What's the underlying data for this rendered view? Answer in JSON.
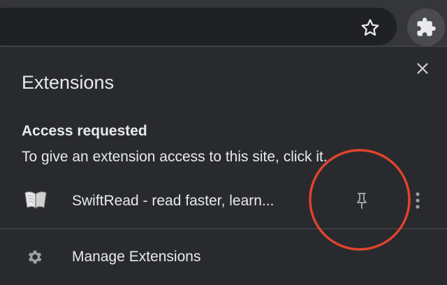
{
  "panel": {
    "title": "Extensions",
    "section_heading": "Access requested",
    "section_desc": "To give an extension access to this site, click it."
  },
  "extensions": [
    {
      "name": "SwiftRead - read faster, learn...",
      "icon": "open-book-icon"
    }
  ],
  "footer": {
    "manage_label": "Manage Extensions",
    "icon": "gear-icon"
  },
  "icons": {
    "star": "star-icon",
    "extensions": "puzzle-piece-icon",
    "close": "close-icon",
    "pin": "pin-icon",
    "more": "more-vertical-icon"
  },
  "colors": {
    "annotation": "#e0442d",
    "panel_bg": "#292a2d",
    "text": "#e8eaed"
  }
}
